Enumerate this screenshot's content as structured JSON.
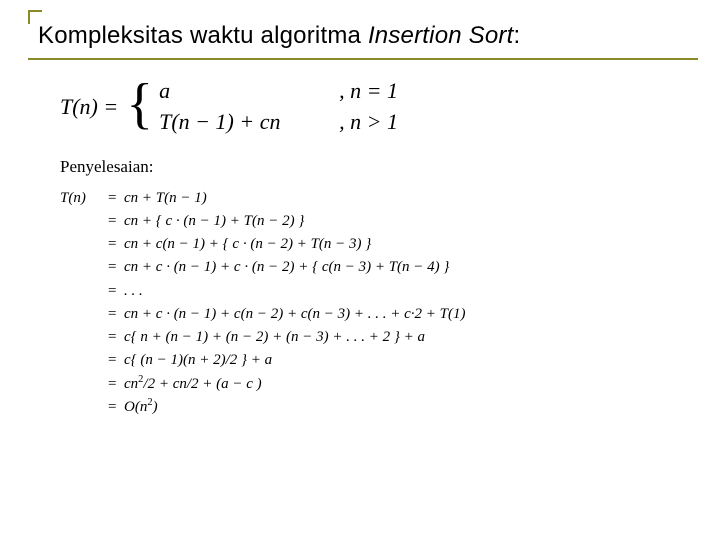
{
  "title": {
    "plain": "Kompleksitas waktu algoritma ",
    "emph": "Insertion Sort",
    "tail": ":"
  },
  "piecewise": {
    "lhs": "T(n) =",
    "cases": [
      {
        "expr": "a",
        "cond": ", n = 1"
      },
      {
        "expr": "T(n − 1) + cn",
        "cond": ", n > 1"
      }
    ]
  },
  "penyelesaian": "Penyelesaian:",
  "deriv": {
    "lhs": "T(n)",
    "lines": [
      "cn + T(n − 1)",
      "cn + { c · (n − 1) + T(n − 2) }",
      "cn + c(n − 1) + { c · (n − 2) + T(n − 3) }",
      "cn + c · (n − 1) + c · (n − 2) + { c(n − 3) + T(n − 4) }",
      ". . .",
      "cn + c · (n − 1) + c(n − 2) + c(n − 3) + . . . + c·2 + T(1)",
      "c{ n + (n − 1) + (n − 2) + (n − 3) + . . . + 2 } + a",
      "c{ (n − 1)(n + 2)/2 } + a",
      "{SQ_HALF_PLUS}",
      "{BIG_O}"
    ]
  },
  "special": {
    "sq_half_plus_prefix": "cn",
    "sq_half_plus_mid": "/2 + cn/2 + (a − c )",
    "bigO_prefix": "O(n",
    "bigO_suffix": ")"
  }
}
